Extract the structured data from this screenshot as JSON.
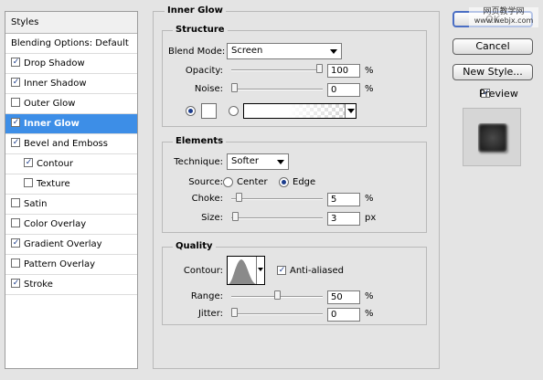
{
  "styles_list": {
    "header": "Styles",
    "items": [
      {
        "label": "Blending Options: Default",
        "checkbox": false,
        "checked": false,
        "indent": false,
        "selected": false
      },
      {
        "label": "Drop Shadow",
        "checkbox": true,
        "checked": true,
        "indent": false,
        "selected": false
      },
      {
        "label": "Inner Shadow",
        "checkbox": true,
        "checked": true,
        "indent": false,
        "selected": false
      },
      {
        "label": "Outer Glow",
        "checkbox": true,
        "checked": false,
        "indent": false,
        "selected": false
      },
      {
        "label": "Inner Glow",
        "checkbox": true,
        "checked": true,
        "indent": false,
        "selected": true
      },
      {
        "label": "Bevel and Emboss",
        "checkbox": true,
        "checked": true,
        "indent": false,
        "selected": false
      },
      {
        "label": "Contour",
        "checkbox": true,
        "checked": true,
        "indent": true,
        "selected": false
      },
      {
        "label": "Texture",
        "checkbox": true,
        "checked": false,
        "indent": true,
        "selected": false
      },
      {
        "label": "Satin",
        "checkbox": true,
        "checked": false,
        "indent": false,
        "selected": false
      },
      {
        "label": "Color Overlay",
        "checkbox": true,
        "checked": false,
        "indent": false,
        "selected": false
      },
      {
        "label": "Gradient Overlay",
        "checkbox": true,
        "checked": true,
        "indent": false,
        "selected": false
      },
      {
        "label": "Pattern Overlay",
        "checkbox": true,
        "checked": false,
        "indent": false,
        "selected": false
      },
      {
        "label": "Stroke",
        "checkbox": true,
        "checked": true,
        "indent": false,
        "selected": false
      }
    ]
  },
  "inner_glow": {
    "title": "Inner Glow",
    "structure": {
      "title": "Structure",
      "blend_mode_label": "Blend Mode:",
      "blend_mode_value": "Screen",
      "opacity_label": "Opacity:",
      "opacity_value": "100",
      "opacity_unit": "%",
      "noise_label": "Noise:",
      "noise_value": "0",
      "noise_unit": "%",
      "opacity_fraction": 1.0,
      "noise_fraction": 0.0,
      "color_swatch": "#ffffff"
    },
    "elements": {
      "title": "Elements",
      "technique_label": "Technique:",
      "technique_value": "Softer",
      "source_label": "Source:",
      "source_center": "Center",
      "source_edge": "Edge",
      "choke_label": "Choke:",
      "choke_value": "5",
      "choke_unit": "%",
      "choke_fraction": 0.05,
      "size_label": "Size:",
      "size_value": "3",
      "size_unit": "px",
      "size_fraction": 0.012
    },
    "quality": {
      "title": "Quality",
      "contour_label": "Contour:",
      "anti_aliased_label": "Anti-aliased",
      "range_label": "Range:",
      "range_value": "50",
      "range_unit": "%",
      "range_fraction": 0.5,
      "jitter_label": "Jitter:",
      "jitter_value": "0",
      "jitter_unit": "%",
      "jitter_fraction": 0.0
    }
  },
  "buttons": {
    "ok": "OK",
    "cancel": "Cancel",
    "new_style": "New Style...",
    "preview_label": "Preview"
  },
  "watermark": {
    "line1": "网页教学网",
    "line2": "www.webjx.com"
  },
  "colors": {
    "selection": "#3d8ee7",
    "panel_bg": "#e4e4e4",
    "check_color": "#1b3c8c"
  }
}
